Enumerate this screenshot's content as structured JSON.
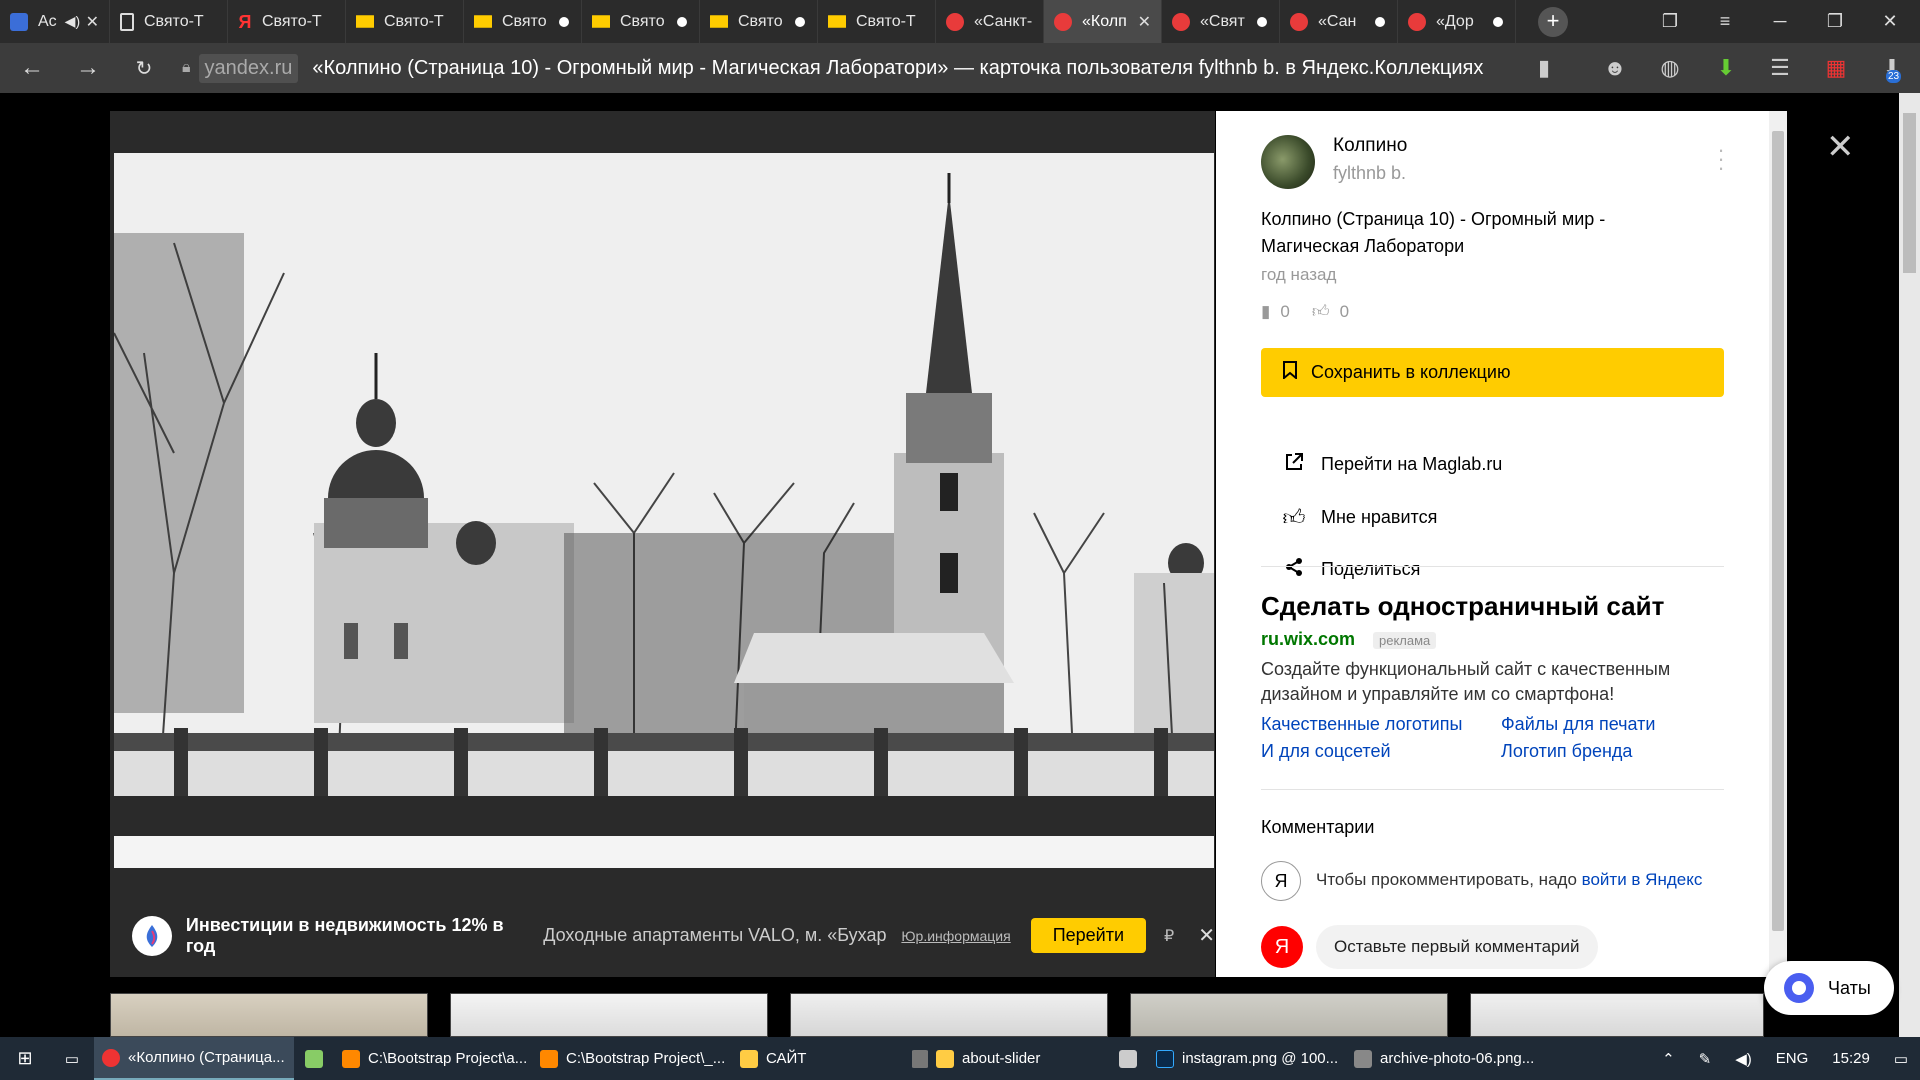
{
  "browser": {
    "tabs": [
      {
        "label": "Ас",
        "favicon": "media-icon",
        "state": "audio"
      },
      {
        "label": "Свято-Т",
        "favicon": "doc-icon"
      },
      {
        "label": "Свято-Т",
        "favicon": "yandex-icon"
      },
      {
        "label": "Свято-Т",
        "favicon": "collections-icon"
      },
      {
        "label": "Свято",
        "favicon": "collections-icon",
        "state": "dot"
      },
      {
        "label": "Свято",
        "favicon": "collections-icon",
        "state": "dot"
      },
      {
        "label": "Свято",
        "favicon": "collections-icon",
        "state": "dot"
      },
      {
        "label": "Свято-Т",
        "favicon": "collections-icon"
      },
      {
        "label": "«Санкт-",
        "favicon": "red-icon"
      },
      {
        "label": "«Колп",
        "favicon": "red-icon",
        "state": "close",
        "active": true
      },
      {
        "label": "«Свят",
        "favicon": "red-icon",
        "state": "dot"
      },
      {
        "label": "«Сан",
        "favicon": "red-icon",
        "state": "dot"
      },
      {
        "label": "«Дор",
        "favicon": "red-icon",
        "state": "dot"
      }
    ],
    "domain": "yandex.ru",
    "title": "«Колпино (Страница 10) - Огромный мир - Магическая Лаборатори» — карточка пользователя fylthnb b. в Яндекс.Коллекциях",
    "badge_count": "23"
  },
  "ad": {
    "title": "Инвестиции в недвижимость 12% в год",
    "text": "Доходные апартаменты VALO, м. «Бухарестская»",
    "legal": "Юр.информация",
    "button": "Перейти",
    "rub": "₽"
  },
  "card": {
    "author_name": "Колпино",
    "author_login": "fylthnb b.",
    "title": "Колпино (Страница 10) - Огромный мир - Магическая Лаборатори",
    "date": "год назад",
    "bookmarks": "0",
    "likes": "0",
    "save_button": "Сохранить в коллекцию",
    "goto_link": "Перейти на Maglab.ru",
    "like_action": "Мне нравится",
    "share_action": "Поделиться"
  },
  "promo": {
    "title": "Сделать одностраничный сайт",
    "domain": "ru.wix.com",
    "badge": "реклама",
    "description": "Создайте функциональный сайт с качественным дизайном и управляйте им со смартфона!",
    "links": [
      "Качественные логотипы",
      "Файлы для печати",
      "И для соцсетей",
      "Логотип бренда"
    ]
  },
  "comments": {
    "heading": "Комментарии",
    "prompt": "Чтобы прокомментировать, надо ",
    "login_link": "войти в Яндекс",
    "ya_letter": "Я",
    "first_comment": "Оставьте первый комментарий"
  },
  "chats": {
    "label": "Чаты"
  },
  "taskbar": {
    "items": [
      {
        "label": "«Колпино (Страница...",
        "icon": "yandex-browser-icon",
        "active": true
      },
      {
        "label": "",
        "icon": "notepad-icon"
      },
      {
        "label": "C:\\Bootstrap Project\\a...",
        "icon": "sublime-icon"
      },
      {
        "label": "C:\\Bootstrap Project\\_...",
        "icon": "sublime-icon"
      },
      {
        "label": "САЙТ",
        "icon": "folder-icon"
      },
      {
        "label": "",
        "icon": "gimp-icon"
      },
      {
        "label": "about-slider",
        "icon": "folder-icon"
      },
      {
        "label": "",
        "icon": "calculator-icon"
      },
      {
        "label": "instagram.png @ 100...",
        "icon": "photoshop-icon"
      },
      {
        "label": "archive-photo-06.png...",
        "icon": "pen-icon"
      }
    ],
    "lang": "ENG",
    "time": "15:29"
  }
}
